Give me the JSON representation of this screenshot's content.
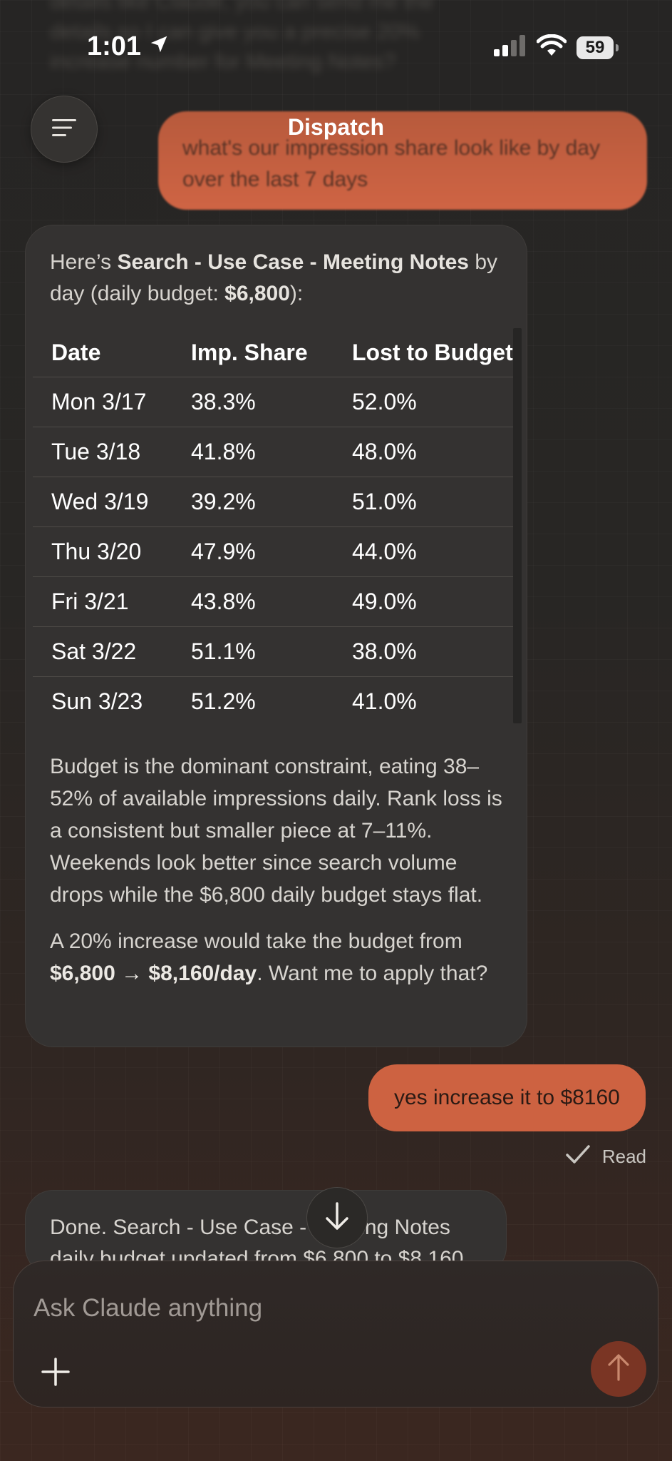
{
  "status_bar": {
    "time": "1:01",
    "battery": "59"
  },
  "header": {
    "title": "Dispatch"
  },
  "background_ghost_text": "details like Claude, you can send me the details so I can give you a precise 20% increase number for Meeting Notes?",
  "messages": {
    "user_1": "what's our impression share look like by day over the last 7 days",
    "assistant_1": {
      "intro_prefix": "Here’s ",
      "campaign": "Search - Use Case - Meeting Notes",
      "intro_mid": " by day (daily budget: ",
      "budget": "$6,800",
      "intro_suffix": "):",
      "table": {
        "headers": [
          "Date",
          "Imp. Share",
          "Lost to Budget"
        ],
        "rows": [
          [
            "Mon 3/17",
            "38.3%",
            "52.0%"
          ],
          [
            "Tue 3/18",
            "41.8%",
            "48.0%"
          ],
          [
            "Wed 3/19",
            "39.2%",
            "51.0%"
          ],
          [
            "Thu 3/20",
            "47.9%",
            "44.0%"
          ],
          [
            "Fri 3/21",
            "43.8%",
            "49.0%"
          ],
          [
            "Sat 3/22",
            "51.1%",
            "38.0%"
          ],
          [
            "Sun 3/23",
            "51.2%",
            "41.0%"
          ]
        ]
      },
      "paragraph_1": "Budget is the dominant constraint, eating 38–52% of available impressions daily. Rank loss is a consistent but smaller piece at 7–11%. Weekends look better since search volume drops while the $6,800 daily budget stays flat.",
      "paragraph_2_prefix": "A 20% increase would take the budget from ",
      "paragraph_2_bold": "$6,800 → $8,160/day",
      "paragraph_2_suffix": ". Want me to apply that?"
    },
    "user_2": "yes increase it to $8160",
    "read_receipt": "Read",
    "assistant_2": "Done. Search - Use Case - Meeting Notes daily budget updated from $6,800 to $8,160"
  },
  "composer": {
    "placeholder": "Ask Claude anything"
  },
  "icons": {
    "location": "location-arrow-icon",
    "signal": "cellular-signal-icon",
    "wifi": "wifi-icon",
    "menu": "menu-icon",
    "check": "checkmark-icon",
    "scroll_down": "arrow-down-icon",
    "plus": "plus-icon",
    "send": "arrow-up-icon"
  },
  "colors": {
    "user_bubble": "#cd6241",
    "send_button": "#7a3524",
    "card_bg": "#343231"
  }
}
